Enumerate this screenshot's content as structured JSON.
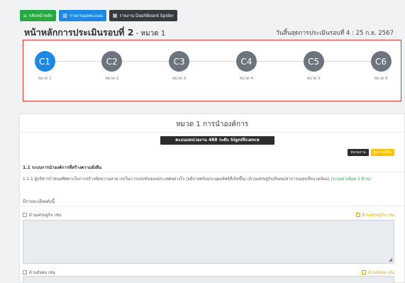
{
  "toolbar": {
    "home_label": "กลับหน้าหลัก",
    "report_label": "รายงานผลคะแนน",
    "spider_label": "รายงาน DashBoard Spider"
  },
  "header": {
    "title": "หน้าหลักการประเมินรอบที่ 2",
    "subtitle": " - หมวด 1",
    "deadline": "วันสิ้นสุดการประเมินรอบที่ 4 : 25 ก.ย. 2567"
  },
  "stepper": {
    "active_index": 0,
    "steps": [
      {
        "code": "C1",
        "label": "หมวด 1"
      },
      {
        "code": "C2",
        "label": "หมวด 2"
      },
      {
        "code": "C3",
        "label": "หมวด 3"
      },
      {
        "code": "C4",
        "label": "หมวด 4"
      },
      {
        "code": "C5",
        "label": "หมวด 5"
      },
      {
        "code": "C6",
        "label": "หมวด 6"
      }
    ]
  },
  "section": {
    "heading": "หมวด 1 การนำองค์การ",
    "score_badge": "คะแนนหน่วยงาน 488 ระดับ Significance",
    "badge_unit": "หน่วยงาน",
    "badge_committee": "ผู้ตรวจเยี่ยม",
    "subsection_title": "1.1 ระบบการนำองค์การที่สร้างความยั่งยืน",
    "question": "1.1.1 ผู้บริหารกำหนดทิศทางในการสร้างขีดความสามารถในการแข่งขันของประเทศอย่างไร (อธิบายพร้อมระบุผลลัพธ์ที่เกิดขึ้น) (ด้านเศรษฐกิจ/สังคม/สาธารณสุข/สิ่งแวดล้อม)",
    "question_note": "(ระบุอย่างน้อย 2 ด้าน)",
    "detail_label": "มีรายละเอียดดังนี้",
    "economic_label": "ด้านเศรษฐกิจ เช่น",
    "economic_right": "ด้านเศรษฐกิจ เช่น",
    "social_label": "ด้านสังคม เช่น",
    "social_right": "ด้านสังคม เช่น"
  },
  "colors": {
    "accent": "#1e88e5",
    "highlight_border": "#e53935",
    "inactive_step": "#6c757d"
  }
}
